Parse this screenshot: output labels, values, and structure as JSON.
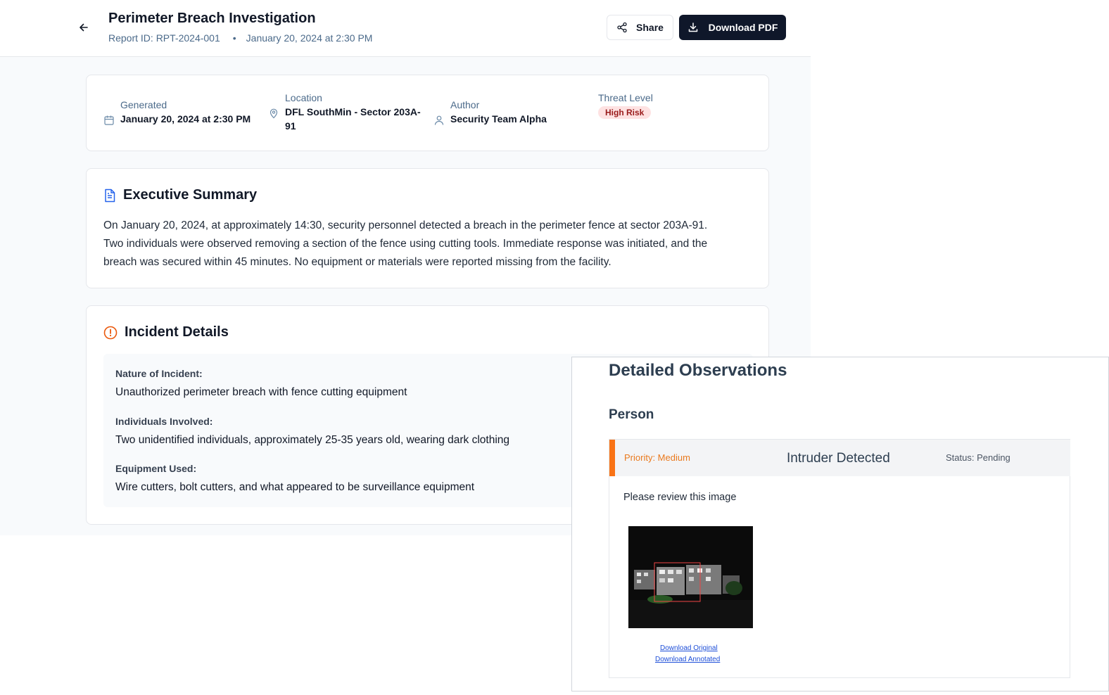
{
  "header": {
    "title": "Perimeter Breach Investigation",
    "report_id": "Report ID: RPT-2024-001",
    "separator": "•",
    "datetime": "January 20, 2024 at 2:30 PM",
    "share_label": "Share",
    "download_label": "Download PDF"
  },
  "meta": {
    "generated_label": "Generated",
    "generated_value": "January 20, 2024 at 2:30 PM",
    "location_label": "Location",
    "location_value_line1": "DFL SouthMin - Sector 203A-",
    "location_value_line2": "91",
    "author_label": "Author",
    "author_value": "Security Team Alpha",
    "threat_label": "Threat Level",
    "threat_value": "High Risk"
  },
  "summary": {
    "heading": "Executive Summary",
    "line1": "On January 20, 2024, at approximately 14:30, security personnel detected a breach in the perimeter fence at sector 203A-91.",
    "line2": "Two individuals were observed removing a section of the fence using cutting tools. Immediate response was initiated, and the",
    "line3": "breach was secured within 45 minutes. No equipment or materials were reported missing from the facility."
  },
  "incident": {
    "heading": "Incident Details",
    "nature_label": "Nature of Incident:",
    "nature_value": "Unauthorized perimeter breach with fence cutting equipment",
    "individuals_label": "Individuals Involved:",
    "individuals_value": "Two unidentified individuals, approximately 25-35 years old, wearing dark clothing",
    "equipment_label": "Equipment Used:",
    "equipment_value": "Wire cutters, bolt cutters, and what appeared to be surveillance equipment"
  },
  "observations": {
    "title": "Detailed Observations",
    "category": "Person",
    "priority": "Priority: Medium",
    "name": "Intruder Detected",
    "status": "Status: Pending",
    "review_text": "Please review this image",
    "download_original": "Download Original",
    "download_annotated": "Download Annotated"
  },
  "colors": {
    "primary_dark": "#0f172a",
    "muted_blue": "#4b6a8a",
    "alert_orange": "#f97316",
    "danger_bg": "#fee2e2",
    "danger_text": "#991b1b",
    "link_blue": "#1d4ed8"
  },
  "icons": {
    "back": "arrow-left-icon",
    "share": "share-icon",
    "download": "download-icon",
    "calendar": "calendar-icon",
    "location": "map-pin-icon",
    "author": "user-icon",
    "summary": "document-icon",
    "incident": "alert-circle-icon"
  }
}
